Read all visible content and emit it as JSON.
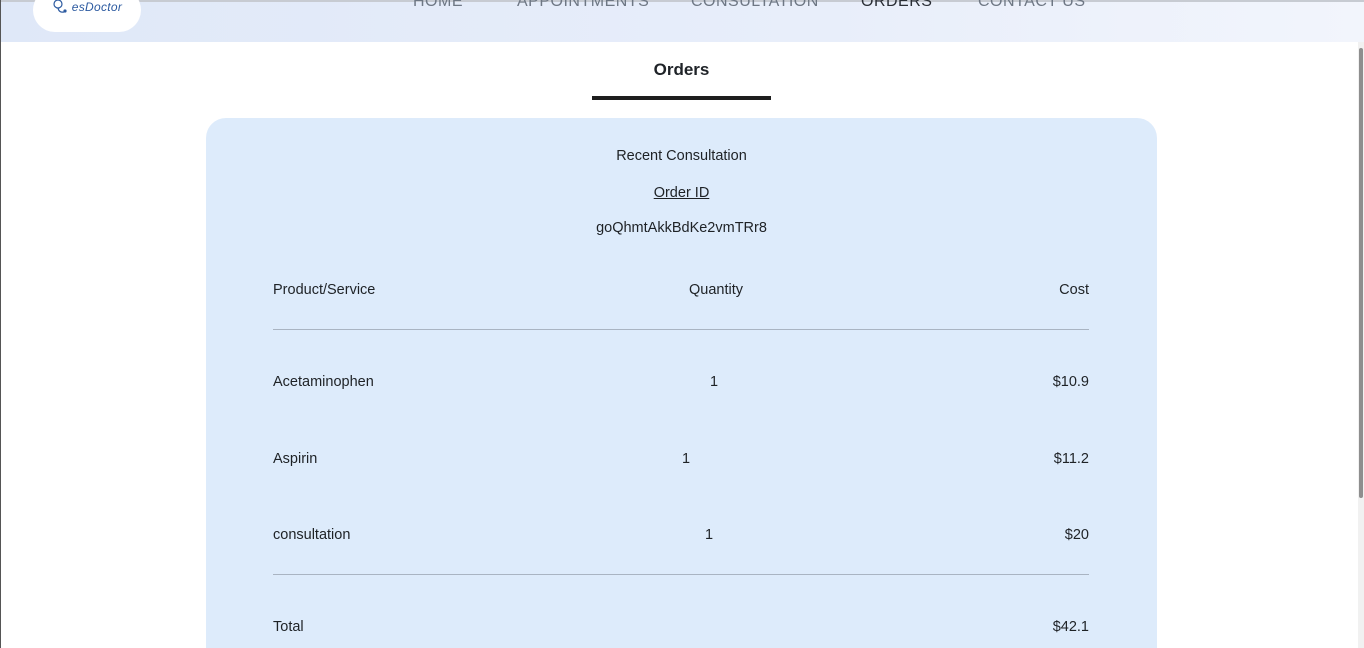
{
  "nav": {
    "logo_text": "esDoctor",
    "items": [
      {
        "label": "HOME"
      },
      {
        "label": "APPOINTMENTS"
      },
      {
        "label": "CONSULTATION"
      },
      {
        "label": "ORDERS"
      },
      {
        "label": "CONTACT US"
      }
    ],
    "active": "ORDERS"
  },
  "tab": {
    "label": "Orders"
  },
  "order": {
    "title": "Recent Consultation",
    "id_label": "Order ID",
    "id_value": "goQhmtAkkBdKe2vmTRr8",
    "columns": [
      "Product/Service",
      "Quantity",
      "Cost"
    ],
    "rows": [
      {
        "product": "Acetaminophen",
        "quantity": "1",
        "cost": "$10.9"
      },
      {
        "product": "Aspirin",
        "quantity": "1",
        "cost": "$11.2"
      },
      {
        "product": "consultation",
        "quantity": "1",
        "cost": "$20"
      }
    ],
    "total_label": "Total",
    "total_value": "$42.1"
  },
  "colors": {
    "card_bg": "#ddebfb",
    "nav_bg": "#dfe8f8",
    "active_underline": "#1e1e1e"
  }
}
